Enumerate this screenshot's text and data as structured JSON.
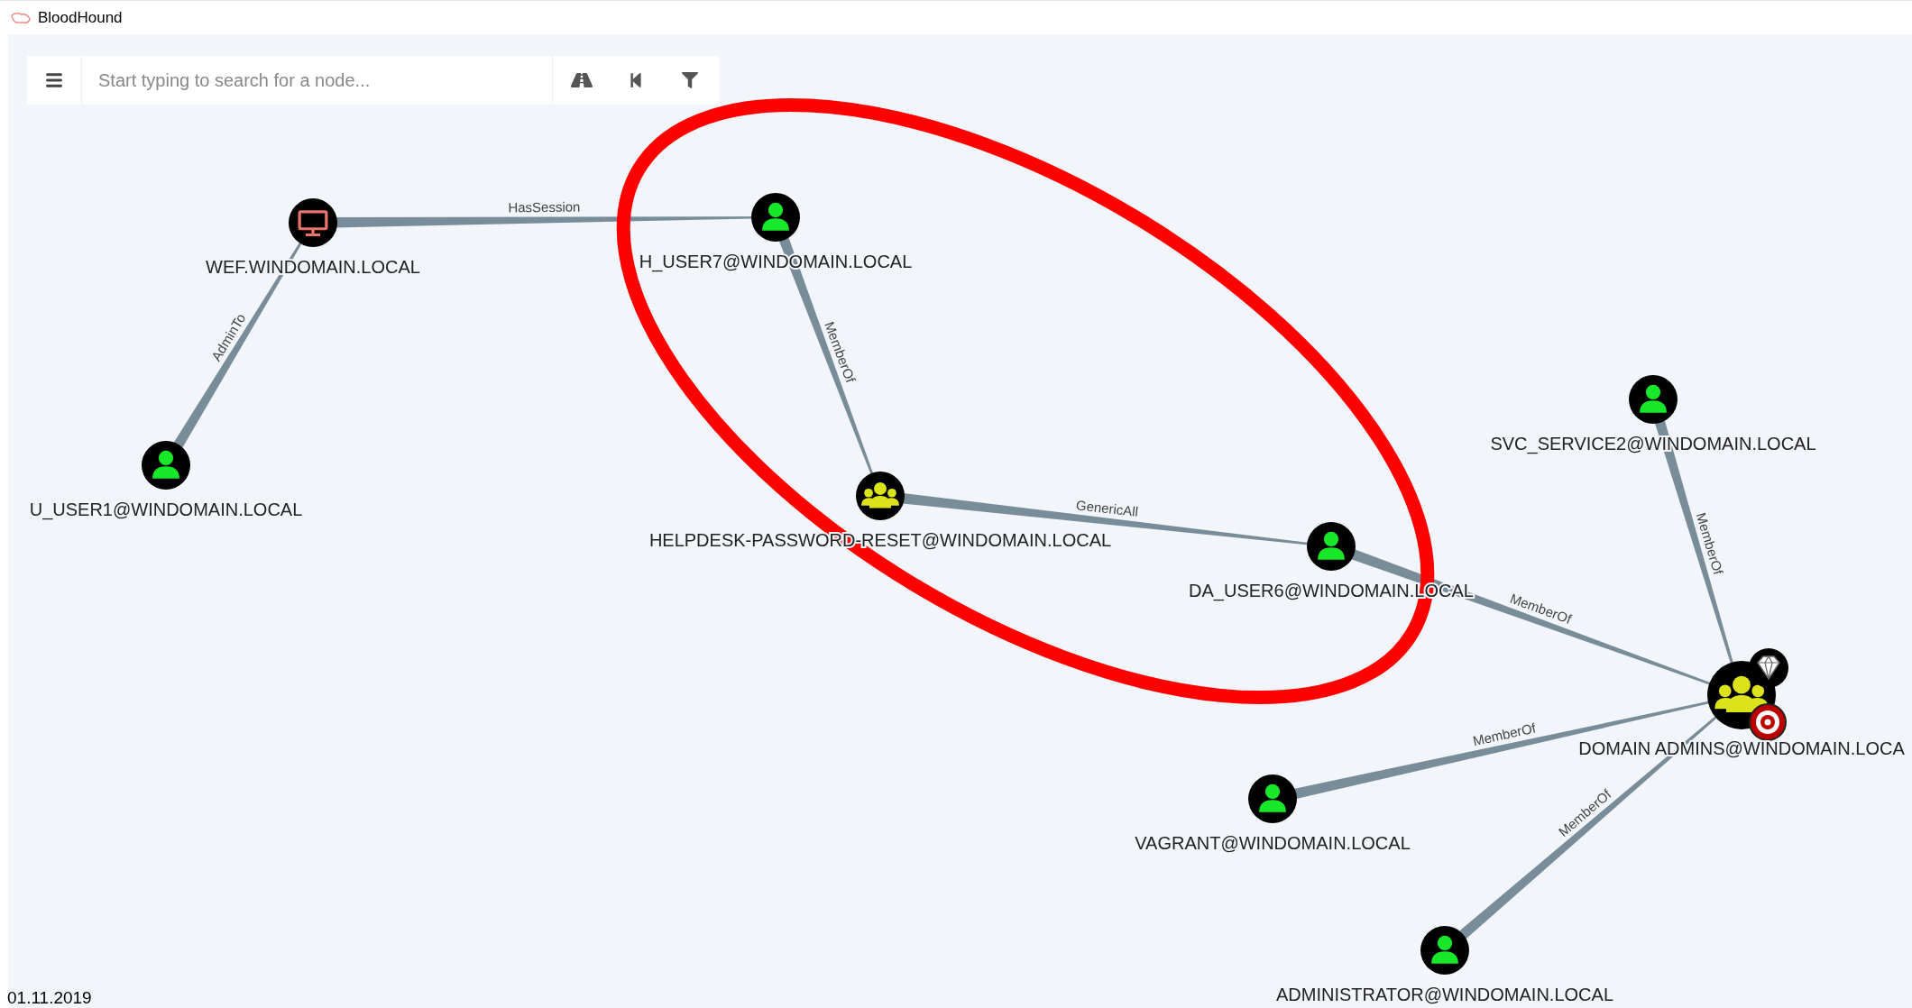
{
  "window": {
    "title": "BloodHound"
  },
  "search": {
    "placeholder": "Start typing to search for a node..."
  },
  "graph": {
    "nodes": [
      {
        "kind": "computer",
        "label": "WEF.WINDOMAIN.LOCAL",
        "high_value": false,
        "target": false
      },
      {
        "kind": "user",
        "label": "H_USER7@WINDOMAIN.LOCAL",
        "high_value": false,
        "target": false
      },
      {
        "kind": "user",
        "label": "U_USER1@WINDOMAIN.LOCAL",
        "high_value": false,
        "target": false
      },
      {
        "kind": "group",
        "label": "HELPDESK-PASSWORD-RESET@WINDOMAIN.LOCAL",
        "high_value": false,
        "target": false
      },
      {
        "kind": "user",
        "label": "DA_USER6@WINDOMAIN.LOCAL",
        "high_value": false,
        "target": false
      },
      {
        "kind": "user",
        "label": "SVC_SERVICE2@WINDOMAIN.LOCAL",
        "high_value": false,
        "target": false
      },
      {
        "kind": "group",
        "label": "DOMAIN ADMINS@WINDOMAIN.LOCA",
        "high_value": true,
        "target": true
      },
      {
        "kind": "user",
        "label": "VAGRANT@WINDOMAIN.LOCAL",
        "high_value": false,
        "target": false
      },
      {
        "kind": "user",
        "label": "ADMINISTRATOR@WINDOMAIN.LOCAL",
        "high_value": false,
        "target": false
      }
    ],
    "edges": [
      {
        "label": "HasSession"
      },
      {
        "label": "AdminTo"
      },
      {
        "label": "MemberOf"
      },
      {
        "label": "GenericAll"
      },
      {
        "label": "MemberOf"
      },
      {
        "label": "MemberOf"
      },
      {
        "label": "MemberOf"
      },
      {
        "label": "MemberOf"
      }
    ]
  },
  "footer_date": "01.11.2019"
}
